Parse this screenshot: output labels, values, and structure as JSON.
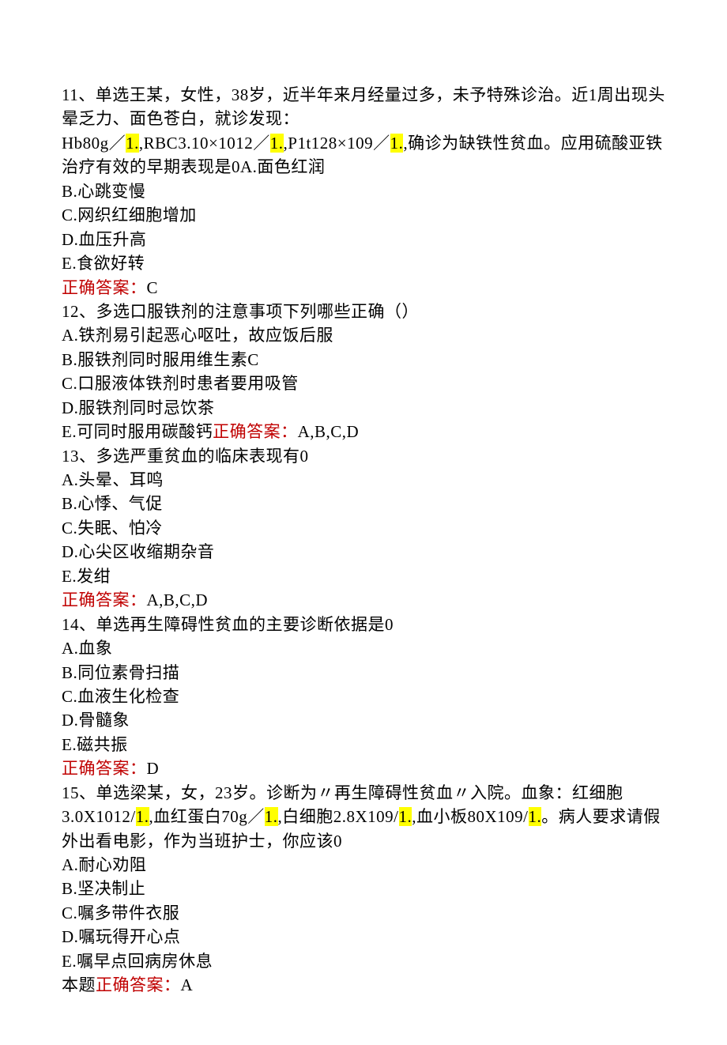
{
  "q11": {
    "stem1": "11、单选王某，女性，38岁，近半年来月经量过多，未予特殊诊治。近1周出现头晕乏力、面色苍白，就诊发现：",
    "stem2a": "Hb80g／",
    "stem2b": ",RBC3.10×1012／",
    "stem2c": ",P1t128×109／",
    "stem2d": ",确诊为缺铁性贫血。应用硫酸亚铁治疗有效的早期表现是0A.面色红润",
    "hl1": "1.",
    "hl2": "1.",
    "hl3": "1.",
    "optB": "B.心跳变慢",
    "optC": "C.网织红细胞增加",
    "optD": "D.血压升高",
    "optE": "E.食欲好转",
    "ansLabel": "正确答案：",
    "ansVal": "C"
  },
  "q12": {
    "stem": "12、多选口服铁剂的注意事项下列哪些正确（）",
    "optA": "A.铁剂易引起恶心呕吐，故应饭后服",
    "optB": "B.服铁剂同时服用维生素C",
    "optC": "C.口服液体铁剂时患者要用吸管",
    "optD": "D.服铁剂同时忌饮茶",
    "optE_pre": "E.可同时服用碳酸钙",
    "ansLabel": "正确答案：",
    "ansVal": "A,B,C,D"
  },
  "q13": {
    "stem": "13、多选严重贫血的临床表现有0",
    "optA": "A.头晕、耳鸣",
    "optB": "B.心悸、气促",
    "optC": "C.失眠、怕冷",
    "optD": "D.心尖区收缩期杂音",
    "optE": "E.发绀",
    "ansLabel": "正确答案：",
    "ansVal": "A,B,C,D"
  },
  "q14": {
    "stem": "14、单选再生障碍性贫血的主要诊断依据是0",
    "optA": "A.血象",
    "optB": "B.同位素骨扫描",
    "optC": "C.血液生化检查",
    "optD": "D.骨髓象",
    "optE": "E.磁共振",
    "ansLabel": "正确答案：",
    "ansVal": "D"
  },
  "q15": {
    "stem1": "15、单选梁某，女，23岁。诊断为〃再生障碍性贫血〃入院。血象：红细胞3.0X1012/",
    "stem2": ",血红蛋白70g／",
    "stem3": ",白细胞2.8X109/",
    "stem4": ",血小板80X109/",
    "stem5": "。病人要求请假外出看电影，作为当班护士，你应该0",
    "hl1": "1.",
    "hl2": "1.",
    "hl3": "1.",
    "hl4": "1.",
    "optA": "A.耐心劝阻",
    "optB": "B.坚决制止",
    "optC": "C.嘱多带件衣服",
    "optD": "D.嘱玩得开心点",
    "optE": "E.嘱早点回病房休息",
    "ansPre": "本题",
    "ansLabel": "正确答案：",
    "ansVal": "A"
  }
}
